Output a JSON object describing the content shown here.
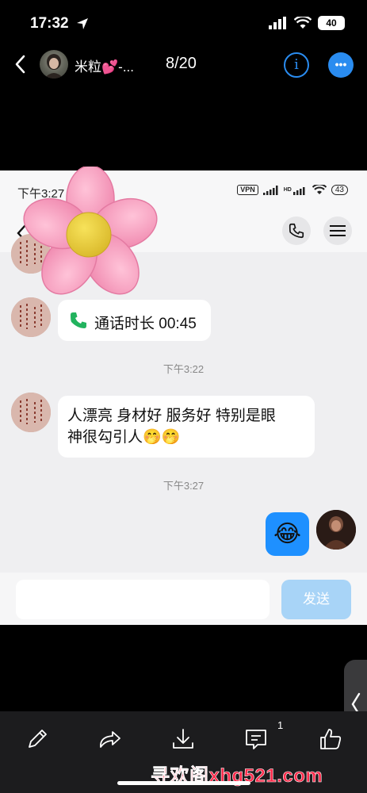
{
  "status_bar": {
    "time": "17:32",
    "battery": "40"
  },
  "header": {
    "contact_name": "米粒💕-...",
    "page_counter": "8/20",
    "info_label": "i",
    "more_label": "•••"
  },
  "screenshot": {
    "status_time": "下午3:27",
    "status_vpn": "VPN",
    "status_hd": "HD",
    "status_battery": "43",
    "messages": [
      {
        "type": "call",
        "text": "通话时长 00:45"
      },
      {
        "type": "timestamp",
        "text": "下午3:22"
      },
      {
        "type": "text",
        "line1": "人漂亮 身材好 服务好 特别是眼",
        "line2": "神很勾引人🤭🤭"
      },
      {
        "type": "timestamp",
        "text": "下午3:27"
      },
      {
        "type": "emoji",
        "text": "😂"
      }
    ],
    "send_label": "发送"
  },
  "toolbar": {
    "comment_badge": "1"
  },
  "watermark": "寻欢阁xhg521.com",
  "colors": {
    "accent": "#2a8cf0",
    "send_disabled": "#a8d4f7",
    "call_green": "#22b35e",
    "watermark": "#ff2a4a"
  }
}
